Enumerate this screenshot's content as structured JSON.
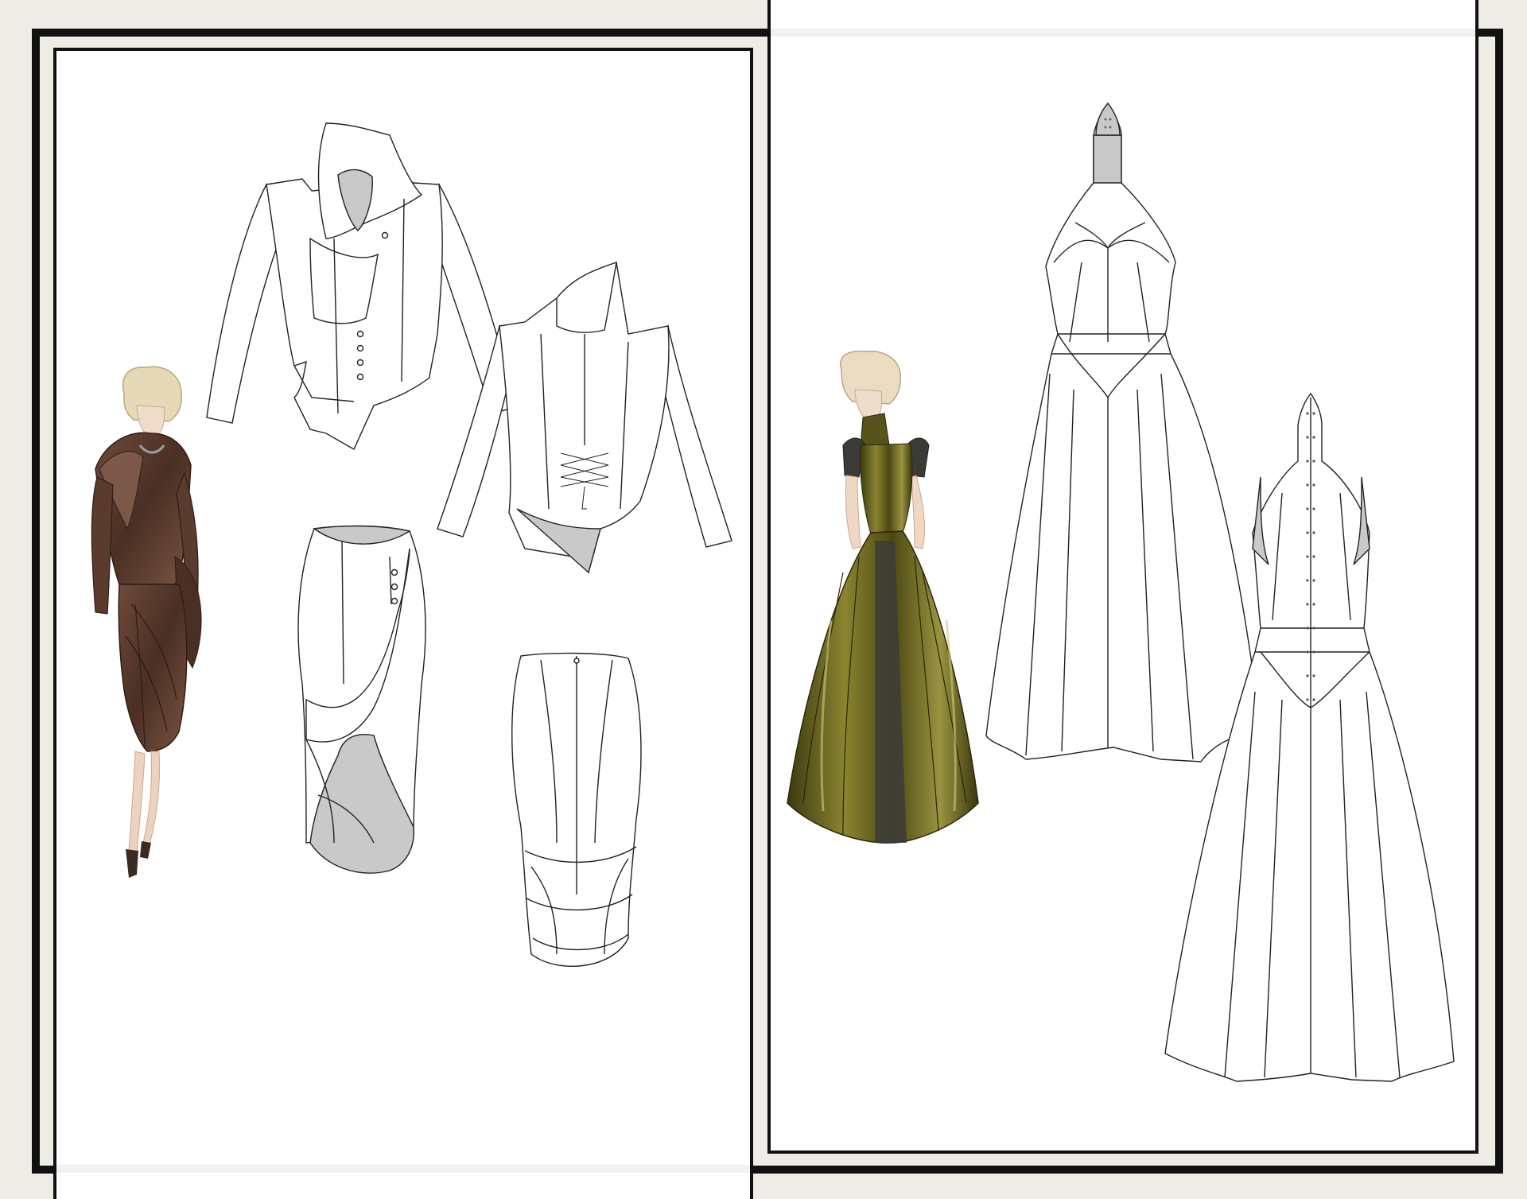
{
  "page": {
    "background": "#efece7",
    "frame_color": "#111111",
    "panel_color": "#ffffff",
    "lining_color": "#c9c9c9"
  },
  "left_board": {
    "figure": {
      "garment": "draped-jacket-and-skirt",
      "color": "#5a3a2c"
    },
    "flats": [
      "jacket-front",
      "jacket-back",
      "skirt-front",
      "skirt-back"
    ]
  },
  "right_board": {
    "figure": {
      "garment": "halter-gown",
      "color": "#5f5a1c"
    },
    "flats": [
      "gown-front",
      "gown-back"
    ]
  }
}
